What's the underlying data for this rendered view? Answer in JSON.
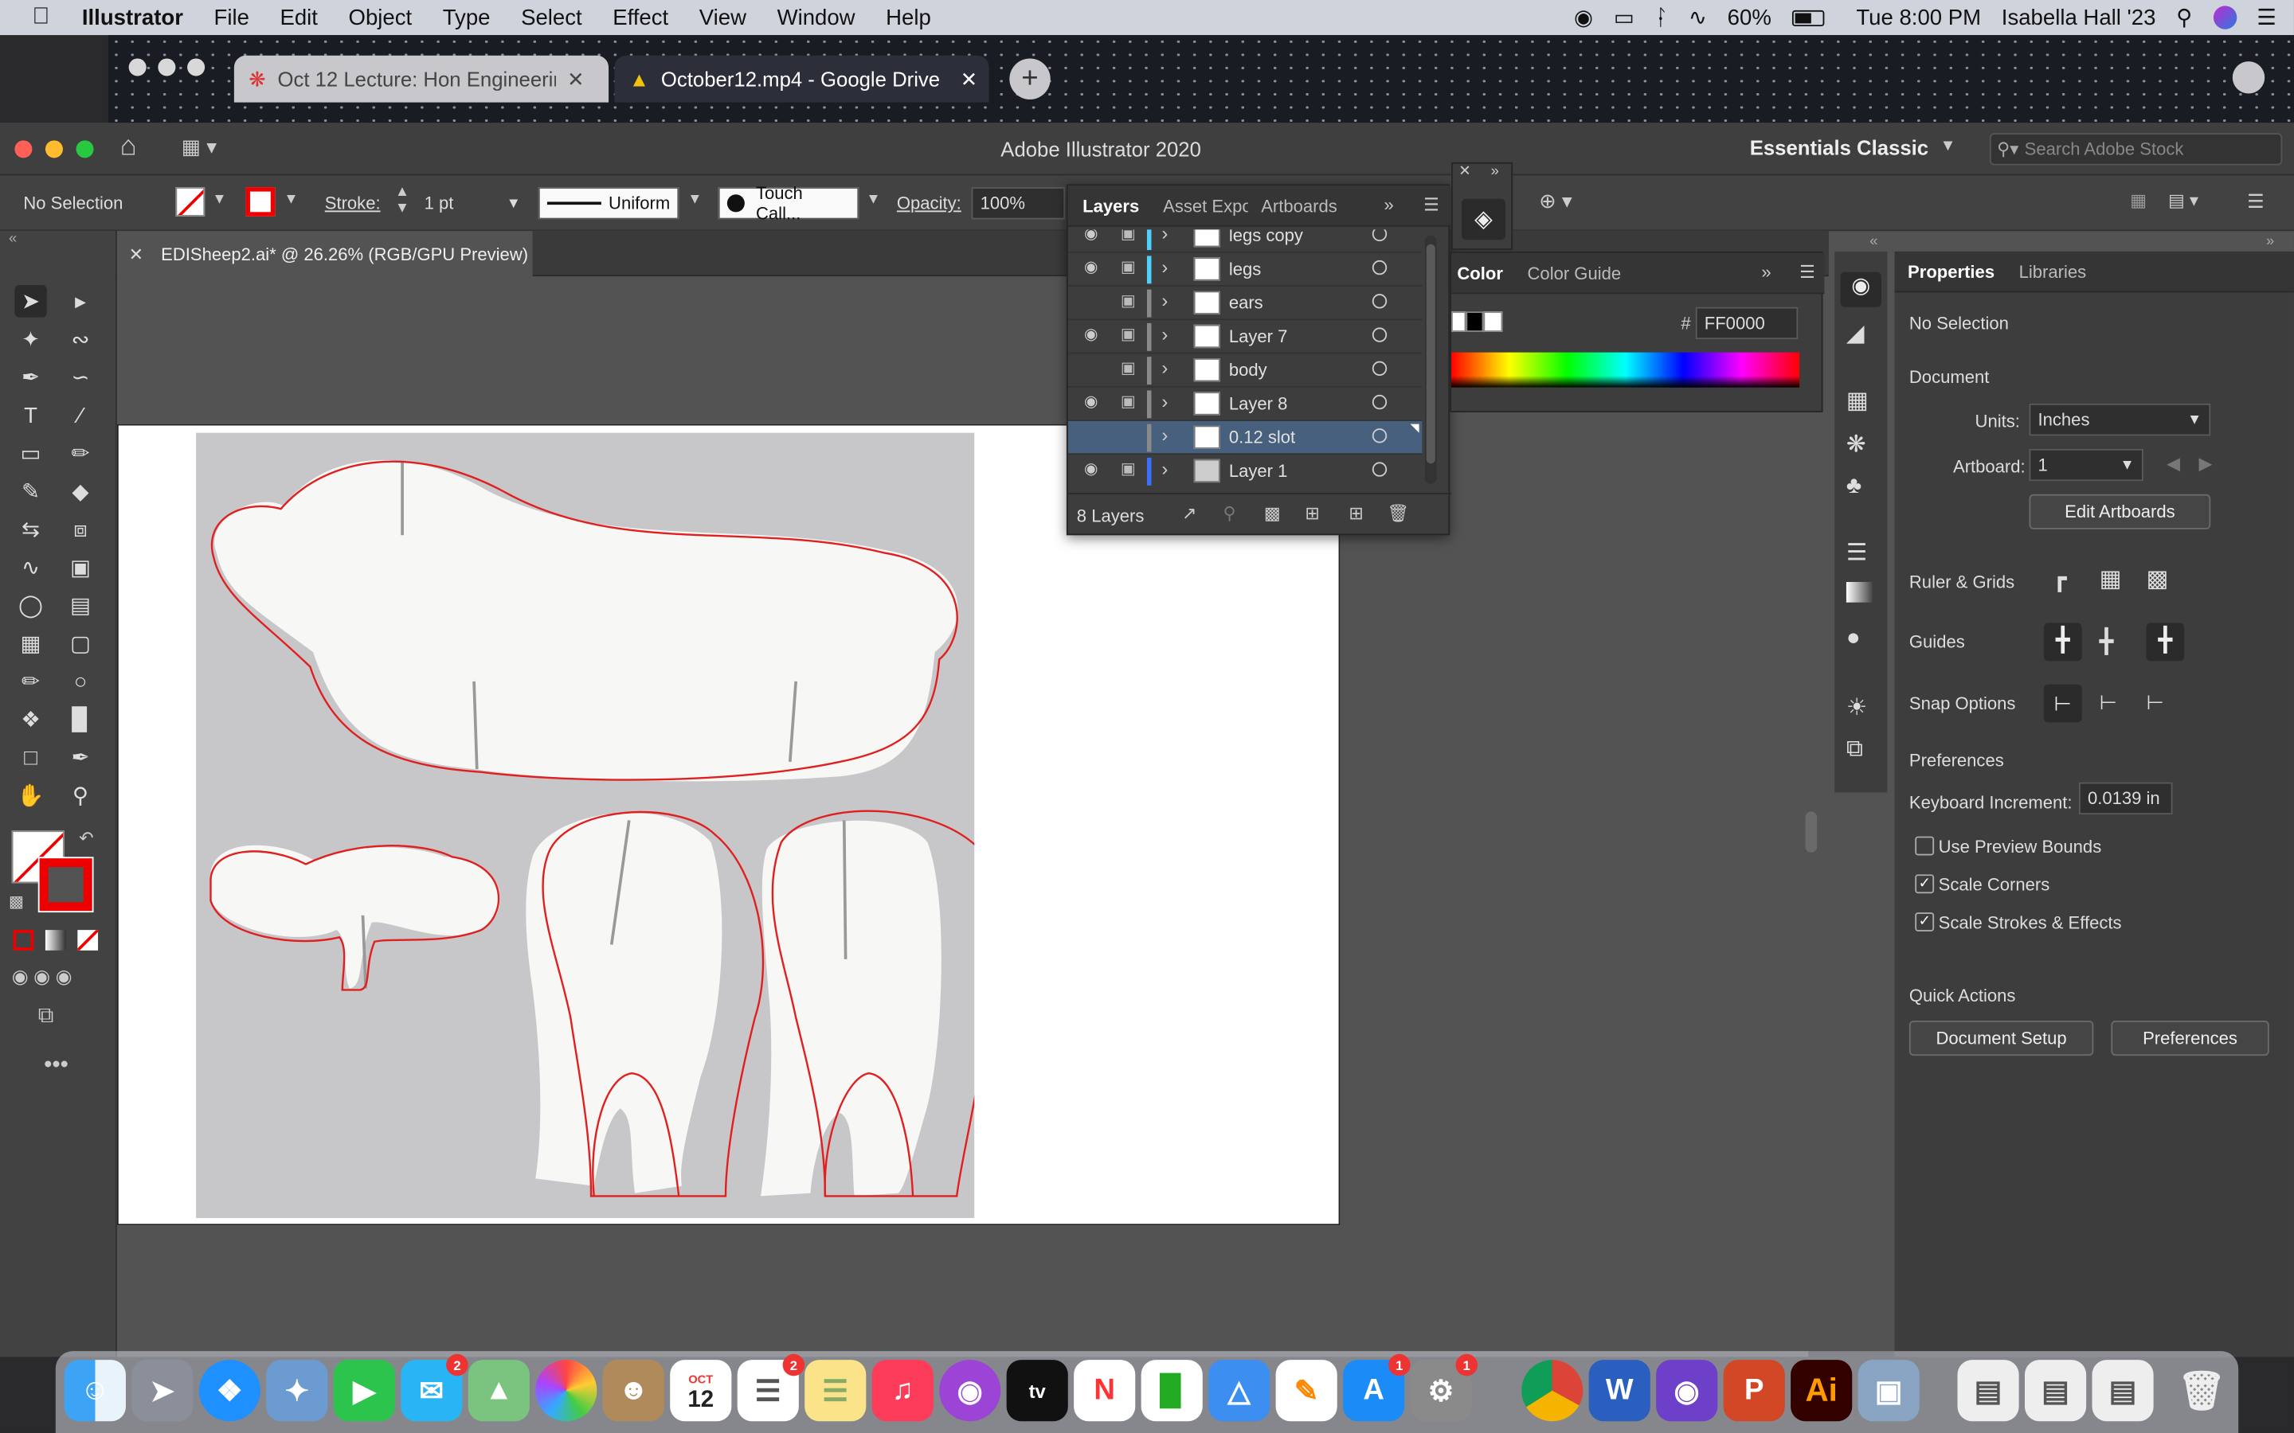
{
  "menubar": {
    "app": "Illustrator",
    "items": [
      "File",
      "Edit",
      "Object",
      "Type",
      "Select",
      "Effect",
      "View",
      "Window",
      "Help"
    ],
    "battery": "60%",
    "clock": "Tue 8:00 PM",
    "user": "Isabella Hall '23"
  },
  "browser": {
    "tabs": [
      {
        "title": "Oct 12 Lecture: Hon Engineerin"
      },
      {
        "title": "October12.mp4 - Google Drive"
      }
    ]
  },
  "window": {
    "title": "Adobe Illustrator 2020",
    "workspace": "Essentials Classic",
    "search_placeholder": "Search Adobe Stock"
  },
  "control": {
    "selection": "No Selection",
    "stroke_label": "Stroke:",
    "stroke_weight": "1 pt",
    "profile": "Uniform",
    "brush": "Touch Call...",
    "opacity_label": "Opacity:",
    "opacity": "100%"
  },
  "document": {
    "tab": "EDISheep2.ai* @ 26.26% (RGB/GPU Preview)"
  },
  "layers_panel": {
    "tabs": [
      "Layers",
      "Asset Expo",
      "Artboards"
    ],
    "rows": [
      {
        "name": "legs copy",
        "visible": true,
        "locked": true,
        "color": "#4fd1ff"
      },
      {
        "name": "legs",
        "visible": true,
        "locked": true,
        "color": "#4fd1ff"
      },
      {
        "name": "ears",
        "visible": false,
        "locked": true,
        "color": "#8a8a8a"
      },
      {
        "name": "Layer 7",
        "visible": true,
        "locked": true,
        "color": "#8a8a8a"
      },
      {
        "name": "body",
        "visible": false,
        "locked": true,
        "color": "#8a8a8a"
      },
      {
        "name": "Layer 8",
        "visible": true,
        "locked": true,
        "color": "#8a8a8a"
      },
      {
        "name": "0.12 slot",
        "visible": false,
        "locked": false,
        "color": "#8a8a8a",
        "selected": true
      },
      {
        "name": "Layer 1",
        "visible": true,
        "locked": true,
        "color": "#3b6fff"
      }
    ],
    "count": "8 Layers"
  },
  "color_panel": {
    "tabs": [
      "Color",
      "Color Guide"
    ],
    "hex_label": "#",
    "hex": "FF0000"
  },
  "properties": {
    "tabs": [
      "Properties",
      "Libraries"
    ],
    "selection": "No Selection",
    "document_heading": "Document",
    "units_label": "Units:",
    "units": "Inches",
    "artboard_label": "Artboard:",
    "artboard": "1",
    "edit_artboards": "Edit Artboards",
    "ruler_grids": "Ruler & Grids",
    "guides": "Guides",
    "snap_options": "Snap Options",
    "preferences_heading": "Preferences",
    "keyboard_increment_label": "Keyboard Increment:",
    "keyboard_increment": "0.0139 in",
    "checks": [
      {
        "label": "Use Preview Bounds",
        "checked": false
      },
      {
        "label": "Scale Corners",
        "checked": true
      },
      {
        "label": "Scale Strokes & Effects",
        "checked": true
      }
    ],
    "quick_actions": "Quick Actions",
    "document_setup": "Document Setup",
    "preferences_button": "Preferences"
  },
  "dock": {
    "calendar_month": "OCT",
    "calendar_day": "12",
    "badges": {
      "messages": "2",
      "reminders": "2",
      "appstore": "1",
      "settings": "1"
    },
    "ai_label": "Ai"
  }
}
